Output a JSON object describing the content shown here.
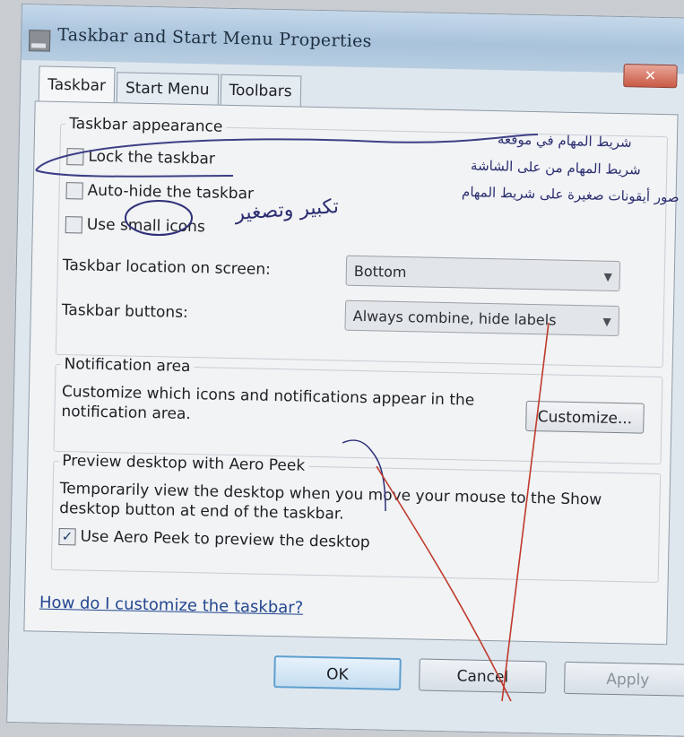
{
  "window": {
    "title": "Taskbar and Start Menu Properties",
    "close_label": "✕"
  },
  "tabs": [
    {
      "label": "Taskbar",
      "active": true
    },
    {
      "label": "Start Menu",
      "active": false
    },
    {
      "label": "Toolbars",
      "active": false
    }
  ],
  "appearance": {
    "group_title": "Taskbar appearance",
    "lock_label": "Lock the taskbar",
    "lock_checked": false,
    "autohide_label": "Auto-hide the taskbar",
    "autohide_checked": false,
    "small_icons_label": "Use small icons",
    "small_icons_checked": false,
    "location_label": "Taskbar location on screen:",
    "location_value": "Bottom",
    "buttons_label": "Taskbar buttons:",
    "buttons_value": "Always combine, hide labels"
  },
  "notification": {
    "group_title": "Notification area",
    "description": "Customize which icons and notifications appear in the notification area.",
    "customize_label": "Customize..."
  },
  "peek": {
    "group_title": "Preview desktop with Aero Peek",
    "description": "Temporarily view the desktop when you move your mouse to the Show desktop button at end of the taskbar.",
    "checkbox_label": "Use Aero Peek to preview the desktop",
    "checked": true
  },
  "help_link": "How do I customize the taskbar?",
  "footer": {
    "ok_label": "OK",
    "cancel_label": "Cancel",
    "apply_label": "Apply"
  },
  "handwriting": {
    "note_1": "شريط المهام في موقعه",
    "note_2": "شريط المهام من على الشاشة",
    "note_3": "صور أيقونات صغيرة على شريط المهام",
    "note_4": "تكبير وتصغير"
  },
  "colors": {
    "window_bg": "#dfe7ee",
    "panel_bg": "#f1f3f5",
    "link": "#24478f",
    "ink_blue": "#2b2d70",
    "ink_red": "#c0392b"
  }
}
